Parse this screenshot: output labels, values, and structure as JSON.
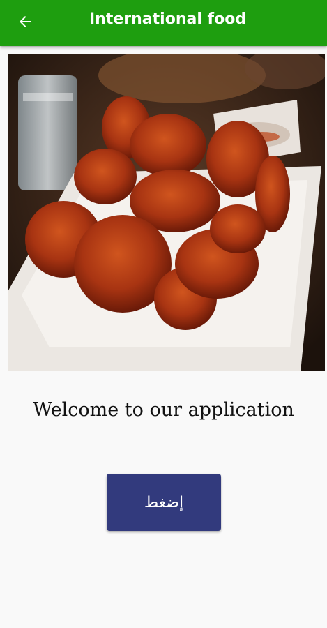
{
  "appbar": {
    "title": "International food",
    "back_icon": "arrow-left-icon",
    "color": "#1e9e0f"
  },
  "main": {
    "image_subject": "fried chicken wings",
    "welcome_text": "Welcome to our application",
    "button_label": "إضغط",
    "button_color": "#323a7d"
  }
}
